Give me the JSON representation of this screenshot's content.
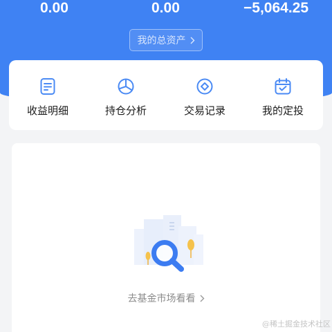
{
  "summary": {
    "values": [
      "0.00",
      "0.00",
      "−5,064.25"
    ],
    "total_assets_label": "我的总资产"
  },
  "menu": {
    "items": [
      {
        "label": "收益明细",
        "icon": "document-icon"
      },
      {
        "label": "持仓分析",
        "icon": "pie-chart-icon"
      },
      {
        "label": "交易记录",
        "icon": "diamond-circle-icon"
      },
      {
        "label": "我的定投",
        "icon": "calendar-check-icon"
      }
    ]
  },
  "empty_state": {
    "action_label": "去基金市场看看",
    "illustration": "search-magnifier-city-illustration"
  },
  "watermark": "@稀土掘金技术社区",
  "colors": {
    "primary": "#3f82f3",
    "accent": "#4a8af4",
    "background": "#f3f4f6",
    "tree": "#f5c24c"
  }
}
